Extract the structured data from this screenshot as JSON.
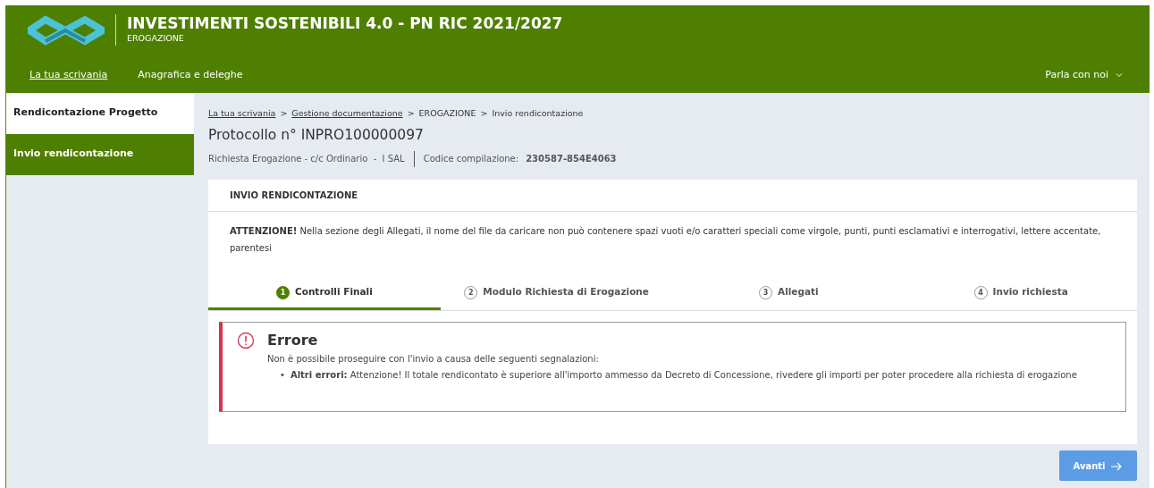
{
  "header": {
    "title": "INVESTIMENTI SOSTENIBILI 4.0 - PN RIC 2021/2027",
    "subtitle": "EROGAZIONE",
    "nav": [
      {
        "label": "La tua scrivania",
        "selected": true
      },
      {
        "label": "Anagrafica e deleghe",
        "selected": false
      }
    ],
    "chat": "Parla con noi"
  },
  "sidebar": {
    "items": [
      {
        "label": "Rendicontazione Progetto",
        "selected": false
      },
      {
        "label": "Invio rendicontazione",
        "selected": true
      }
    ]
  },
  "breadcrumb": [
    {
      "kind": "link",
      "label": "La tua scrivania"
    },
    {
      "kind": "separator",
      "label": ">"
    },
    {
      "kind": "link",
      "label": "Gestione documentazione"
    },
    {
      "kind": "separator",
      "label": ">"
    },
    {
      "kind": "text",
      "label": "EROGAZIONE"
    },
    {
      "kind": "separator",
      "label": ">"
    },
    {
      "kind": "text",
      "label": "Invio rendicontazione"
    }
  ],
  "protocol": "Protocollo n° INPRO100000097",
  "request_info": "Richiesta Erogazione - c/c Ordinario  -  I SAL",
  "code_label": "Codice compilazione:",
  "code_value": "230587-854E4063",
  "panel": {
    "title": "INVIO RENDICONTAZIONE",
    "warning": "**ATTENZIONE!** Nella sezione degli Allegati, il nome del file da caricare non può contenere spazi vuoti e/o caratteri speciali come virgole, punti, punti esclamativi e interrogativi, lettere accentate, parentesi",
    "steps": [
      {
        "number": "1",
        "label": "Controlli Finali",
        "selected": true
      },
      {
        "number": "2",
        "label": "Modulo Richiesta di Erogazione",
        "selected": false
      },
      {
        "number": "3",
        "label": "Allegati",
        "selected": false
      },
      {
        "number": "4",
        "label": "Invio richiesta",
        "selected": false
      }
    ],
    "error": {
      "title": "Errore",
      "message": "Non è possibile proseguire con l'invio a causa delle seguenti segnalazioni:",
      "items": [
        {
          "bullet": "•",
          "text": "**Altri errori:** Attenzione! Il totale rendicontato è superiore all'importo ammesso da Decreto di Concessione, rivedere gli importi per poter procedere alla richiesta di erogazione"
        }
      ]
    }
  },
  "next_button": {
    "label": "Avanti",
    "disabled": true
  }
}
